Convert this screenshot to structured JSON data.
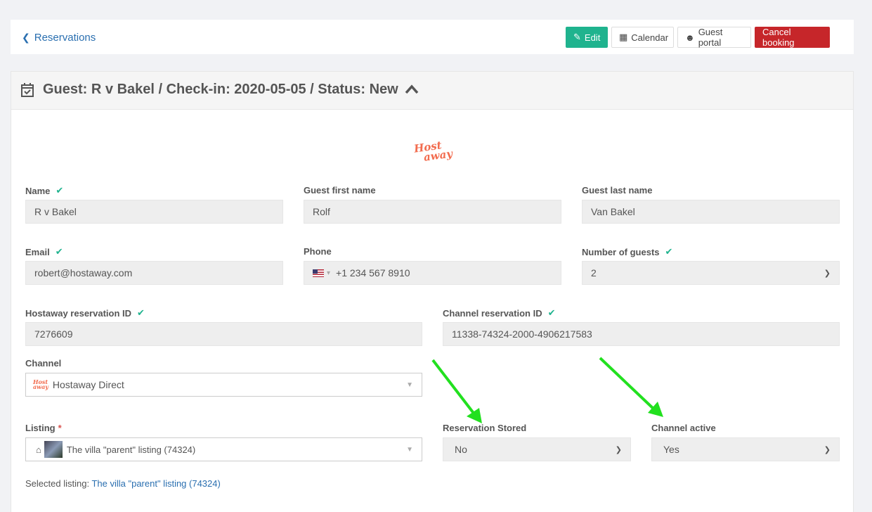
{
  "topbar": {
    "back_label": "Reservations",
    "edit_label": "Edit",
    "calendar_label": "Calendar",
    "portal_label": "Guest portal",
    "cancel_label": "Cancel booking"
  },
  "panel": {
    "title": "Guest: R v Bakel / Check-in: 2020-05-05 / Status: New",
    "logo_line1": "Host",
    "logo_line2": "away"
  },
  "fields": {
    "name_label": "Name",
    "name_value": "R v Bakel",
    "first_label": "Guest first name",
    "first_value": "Rolf",
    "last_label": "Guest last name",
    "last_value": "Van Bakel",
    "email_label": "Email",
    "email_value": "robert@hostaway.com",
    "phone_label": "Phone",
    "phone_value": "+1 234 567 8910",
    "guests_label": "Number of guests",
    "guests_value": "2",
    "hostaway_id_label": "Hostaway reservation ID",
    "hostaway_id_value": "7276609",
    "channel_id_label": "Channel reservation ID",
    "channel_id_value": "11338-74324-2000-4906217583",
    "channel_label": "Channel",
    "channel_value": "Hostaway Direct",
    "listing_label": "Listing",
    "listing_required": "*",
    "listing_value": "The villa \"parent\" listing (74324)",
    "stored_label": "Reservation Stored",
    "stored_value": "No",
    "active_label": "Channel active",
    "active_value": "Yes",
    "selected_prefix": "Selected listing:",
    "selected_link": "The villa \"parent\" listing  (74324)"
  },
  "colors": {
    "accent": "#1fb38e",
    "danger": "#c6262a",
    "link": "#2a6fb0",
    "arrow": "#22e01f"
  }
}
